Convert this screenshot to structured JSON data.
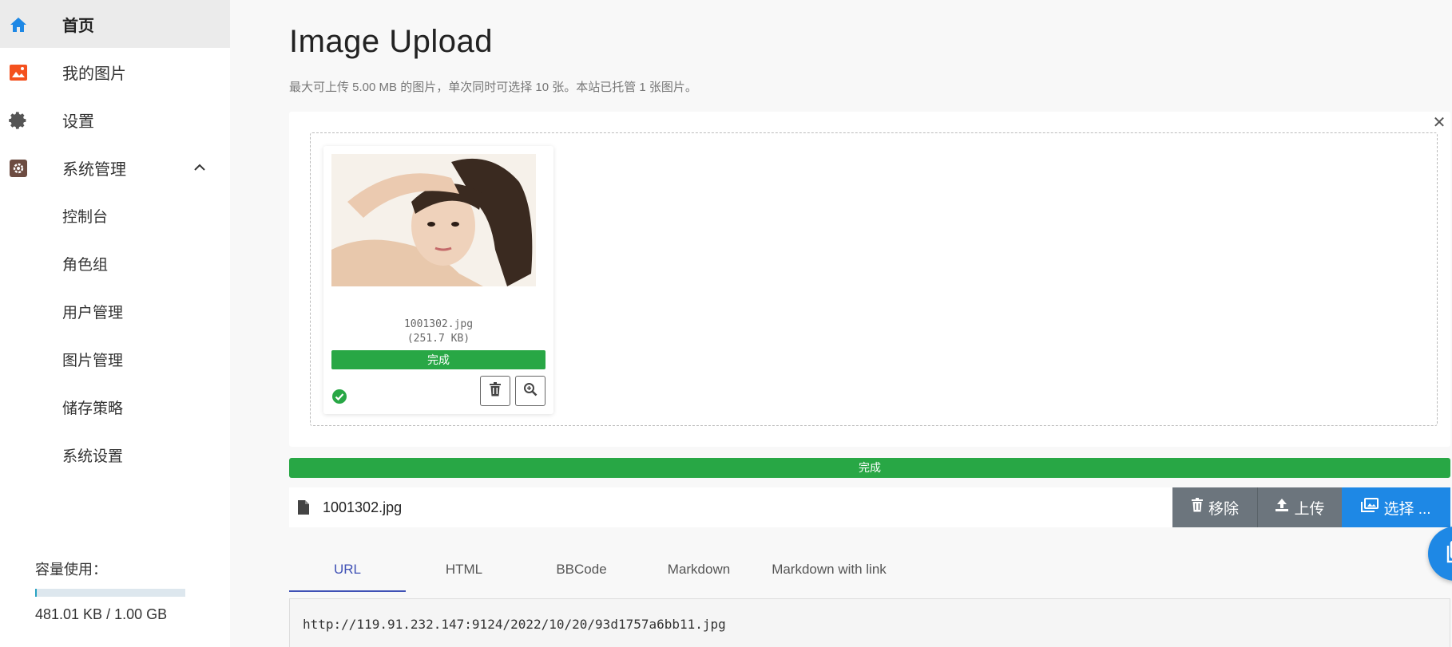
{
  "colors": {
    "accent": "#1e88e5",
    "success": "#28a745",
    "secondary": "#6c757d",
    "tab_active": "#3f51b5"
  },
  "sidebar": {
    "items": [
      {
        "label": "首页",
        "icon": "home-icon",
        "active": true
      },
      {
        "label": "我的图片",
        "icon": "image-icon"
      },
      {
        "label": "设置",
        "icon": "gear-icon"
      },
      {
        "label": "系统管理",
        "icon": "admin-gear-icon",
        "expanded": true
      }
    ],
    "sub_items": [
      {
        "label": "控制台"
      },
      {
        "label": "角色组"
      },
      {
        "label": "用户管理"
      },
      {
        "label": "图片管理"
      },
      {
        "label": "储存策略"
      },
      {
        "label": "系统设置"
      }
    ],
    "capacity": {
      "label": "容量使用：",
      "value": "481.01 KB / 1.00 GB",
      "fraction": 0.0005
    }
  },
  "main": {
    "title": "Image Upload",
    "subtitle": "最大可上传 5.00 MB 的图片，单次同时可选择 10 张。本站已托管 1 张图片。",
    "file_card": {
      "name": "1001302.jpg",
      "size": "(251.7 KB)",
      "progress_label": "完成",
      "progress": 1.0
    },
    "progress_label": "完成",
    "file_bar": {
      "name": "1001302.jpg",
      "remove_label": "移除",
      "upload_label": "上传",
      "select_label": "选择 ..."
    },
    "tabs": [
      {
        "label": "URL",
        "active": true
      },
      {
        "label": "HTML"
      },
      {
        "label": "BBCode"
      },
      {
        "label": "Markdown"
      },
      {
        "label": "Markdown with link"
      }
    ],
    "url_output": "http://119.91.232.147:9124/2022/10/20/93d1757a6bb11.jpg"
  }
}
